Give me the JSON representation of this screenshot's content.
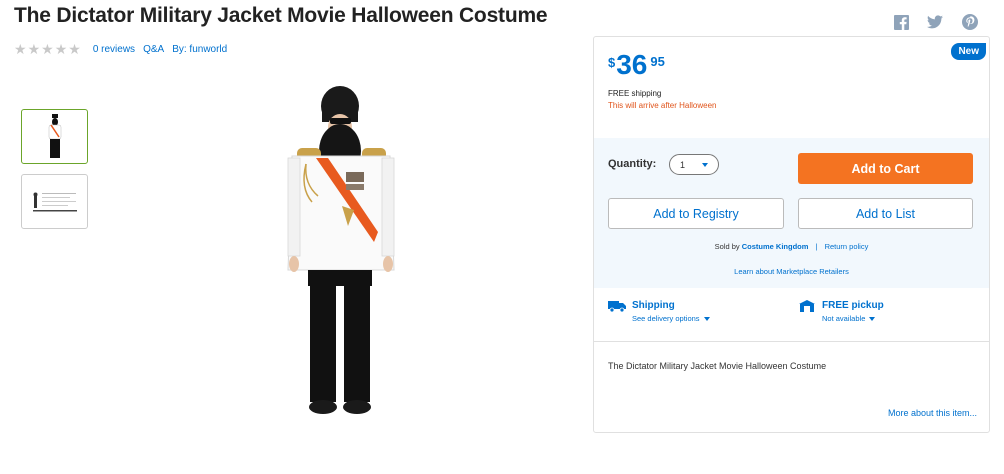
{
  "product": {
    "title": "The Dictator Military Jacket Movie Halloween Costume",
    "reviews": "0 reviews",
    "qa": "Q&A",
    "brand": "By: funworld",
    "star_count": 5
  },
  "social": [
    "facebook-icon",
    "twitter-icon",
    "pinterest-icon"
  ],
  "offer": {
    "badge": "New",
    "currency": "$",
    "price_dollars": "36",
    "price_cents": "95",
    "shipping_note": "FREE shipping",
    "arrival_note": "This will arrive after Halloween",
    "quantity_label": "Quantity:",
    "quantity_value": "1",
    "add_to_cart": "Add to Cart",
    "add_to_registry": "Add to Registry",
    "add_to_list": "Add to List",
    "sold_by_prefix": "Sold by",
    "seller": "Costume Kingdom",
    "separator": "|",
    "return_policy": "Return policy",
    "learn_more": "Learn about Marketplace Retailers"
  },
  "fulfillment": {
    "shipping_label": "Shipping",
    "shipping_sub": "See delivery options",
    "pickup_label": "FREE pickup",
    "pickup_sub": "Not available"
  },
  "description": {
    "text": "The Dictator Military Jacket Movie Halloween Costume",
    "more": "More about this item..."
  },
  "colors": {
    "brand_blue": "#0071ce",
    "cart_orange": "#f47321",
    "selected_thumb_green": "#6ba52a",
    "alert_orange": "#e0541b",
    "action_panel_bg": "#f2f8fd"
  }
}
